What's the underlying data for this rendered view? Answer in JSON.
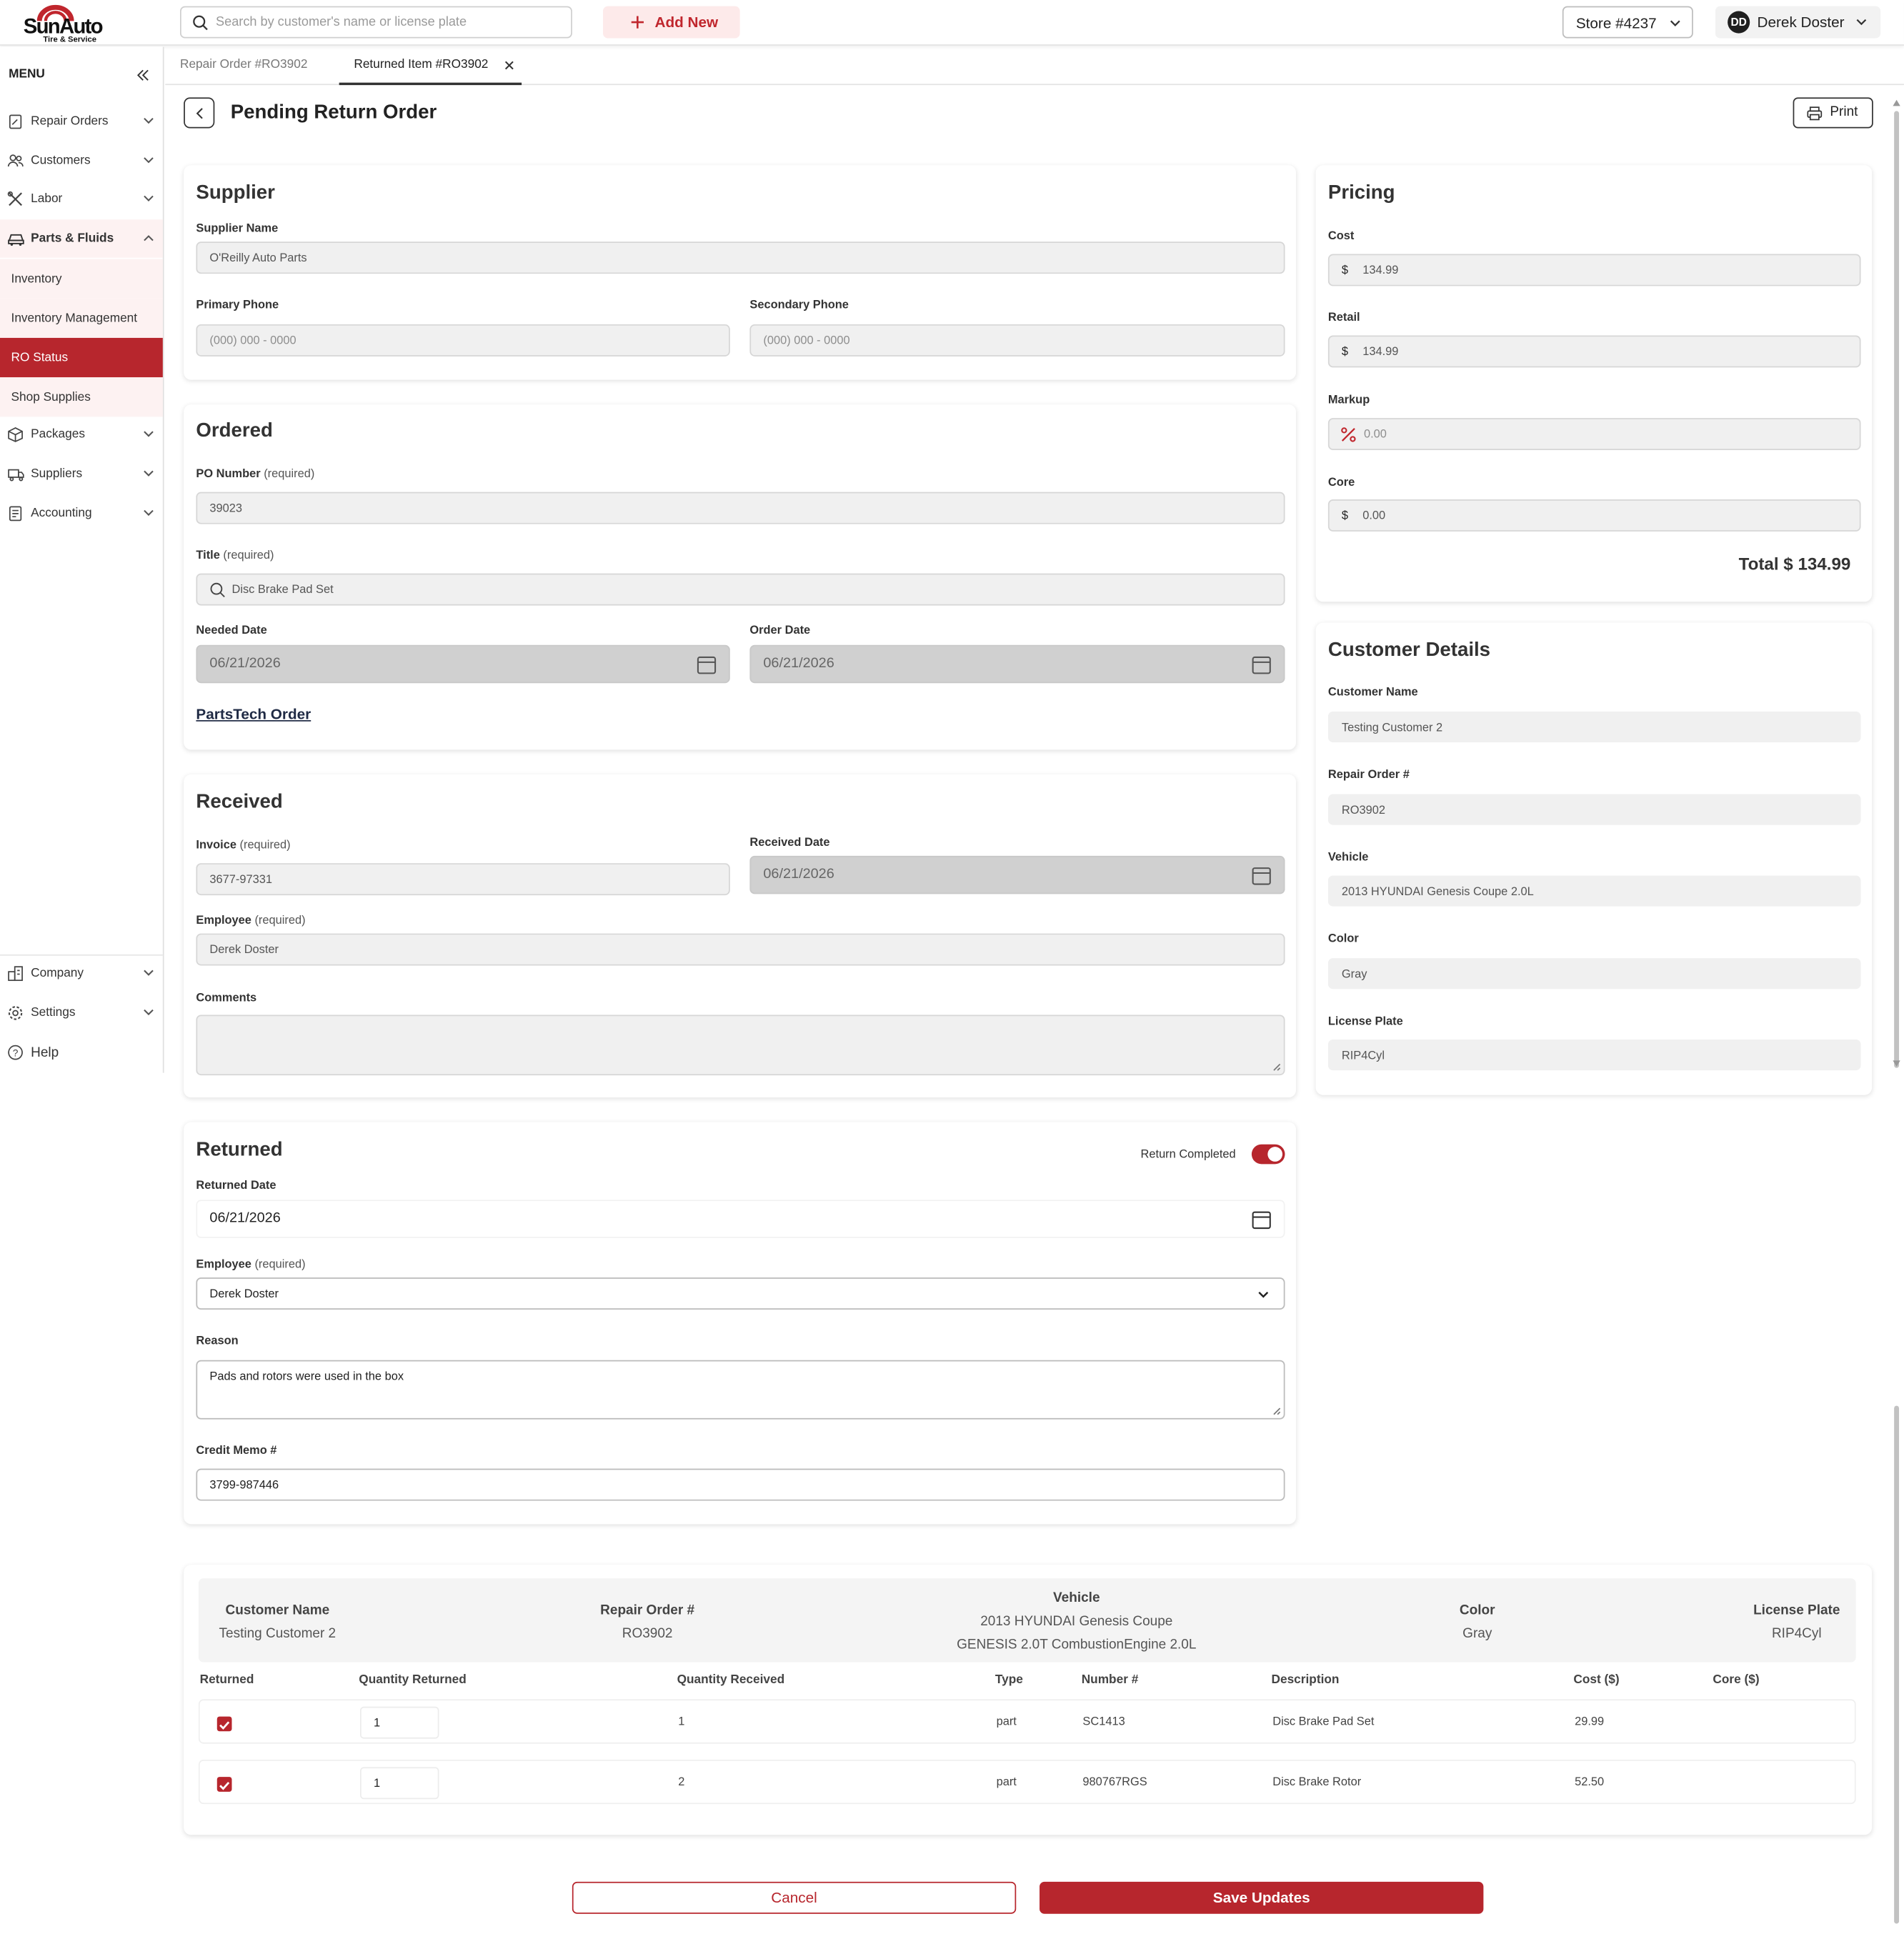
{
  "brand": {
    "name": "SunAuto",
    "tagline": "Tire & Service",
    "color": "#b7262d"
  },
  "topbar": {
    "search_placeholder": "Search by customer's name or license plate",
    "add_new": "Add New",
    "store": "Store #4237",
    "user_initials": "DD",
    "user_name": "Derek Doster"
  },
  "sidebar": {
    "menu_title": "MENU",
    "items": [
      {
        "label": "Repair Orders",
        "icon": "clipboard-icon"
      },
      {
        "label": "Customers",
        "icon": "users-icon"
      },
      {
        "label": "Labor",
        "icon": "tools-icon"
      },
      {
        "label": "Parts & Fluids",
        "icon": "car-icon"
      }
    ],
    "sub_items": [
      {
        "label": "Inventory"
      },
      {
        "label": "Inventory Management"
      },
      {
        "label": "RO Status",
        "active": true
      },
      {
        "label": "Shop Supplies"
      }
    ],
    "items2": [
      {
        "label": "Packages",
        "icon": "box-icon"
      },
      {
        "label": "Suppliers",
        "icon": "truck-icon"
      },
      {
        "label": "Accounting",
        "icon": "ledger-icon"
      }
    ],
    "bottom": [
      {
        "label": "Company",
        "icon": "building-icon"
      },
      {
        "label": "Settings",
        "icon": "gear-icon"
      },
      {
        "label": "Help",
        "icon": "help-icon"
      }
    ]
  },
  "tabs": [
    {
      "label": "Repair Order #RO3902"
    },
    {
      "label": "Returned Item #RO3902",
      "active": true
    }
  ],
  "page": {
    "title": "Pending Return Order",
    "print": "Print"
  },
  "supplier": {
    "title": "Supplier",
    "name_label": "Supplier Name",
    "name": "O'Reilly Auto Parts",
    "primary_label": "Primary Phone",
    "primary_ph": "(000) 000 - 0000",
    "secondary_label": "Secondary Phone",
    "secondary_ph": "(000) 000 - 0000"
  },
  "ordered": {
    "title": "Ordered",
    "po_label": "PO Number",
    "required": "(required)",
    "po": "39023",
    "title_label": "Title",
    "title_value": "Disc Brake Pad Set",
    "needed_label": "Needed Date",
    "needed": "06/21/2026",
    "order_label": "Order Date",
    "order": "06/21/2026",
    "link": "PartsTech Order"
  },
  "received": {
    "title": "Received",
    "invoice_label": "Invoice",
    "invoice": "3677-97331",
    "date_label": "Received Date",
    "date": "06/21/2026",
    "employee_label": "Employee",
    "employee": "Derek Doster",
    "comments_label": "Comments",
    "comments": ""
  },
  "returned": {
    "title": "Returned",
    "toggle_label": "Return Completed",
    "toggle_on": true,
    "date_label": "Returned Date",
    "date": "06/21/2026",
    "employee_label": "Employee",
    "employee": "Derek Doster",
    "reason_label": "Reason",
    "reason": "Pads and rotors were used in the box",
    "memo_label": "Credit Memo #",
    "memo": "3799-987446"
  },
  "pricing": {
    "title": "Pricing",
    "cost_label": "Cost",
    "cost": "134.99",
    "retail_label": "Retail",
    "retail": "134.99",
    "markup_label": "Markup",
    "markup": "0.00",
    "core_label": "Core",
    "core": "0.00",
    "currency": "$",
    "total": "Total $ 134.99"
  },
  "customer": {
    "title": "Customer Details",
    "name_label": "Customer Name",
    "name": "Testing Customer 2",
    "ro_label": "Repair Order #",
    "ro": "RO3902",
    "vehicle_label": "Vehicle",
    "vehicle": "2013 HYUNDAI Genesis Coupe 2.0L",
    "color_label": "Color",
    "color": "Gray",
    "plate_label": "License Plate",
    "plate": "RIP4Cyl"
  },
  "summary": {
    "name_label": "Customer Name",
    "name": "Testing Customer 2",
    "ro_label": "Repair Order #",
    "ro": "RO3902",
    "vehicle_label": "Vehicle",
    "vehicle_line1": "2013 HYUNDAI Genesis Coupe",
    "vehicle_line2": "GENESIS 2.0T CombustionEngine 2.0L",
    "color_label": "Color",
    "color": "Gray",
    "plate_label": "License Plate",
    "plate": "RIP4Cyl"
  },
  "table": {
    "headers": [
      "Returned",
      "Quantity Returned",
      "Quantity Received",
      "Type",
      "Number #",
      "Description",
      "Cost ($)",
      "Core ($)"
    ],
    "rows": [
      {
        "returned": true,
        "qty_returned": "1",
        "qty_received": "1",
        "type": "part",
        "number": "SC1413",
        "description": "Disc Brake Pad Set",
        "cost": "29.99",
        "core": ""
      },
      {
        "returned": true,
        "qty_returned": "1",
        "qty_received": "2",
        "type": "part",
        "number": "980767RGS",
        "description": "Disc Brake Rotor",
        "cost": "52.50",
        "core": ""
      }
    ]
  },
  "actions": {
    "cancel": "Cancel",
    "save": "Save Updates"
  }
}
